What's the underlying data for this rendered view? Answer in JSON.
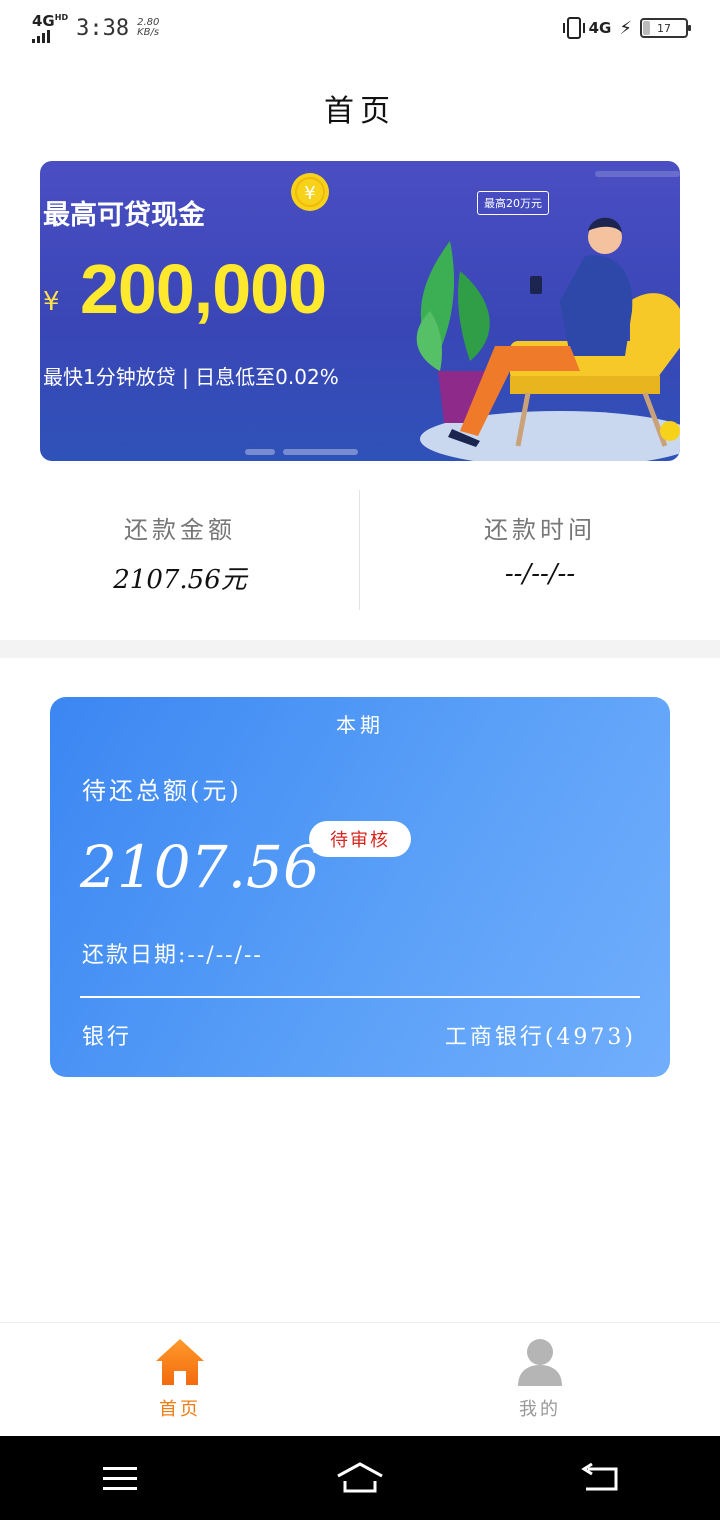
{
  "status_bar": {
    "network_left": "4G",
    "network_left_sup": "HD",
    "time": "3:38",
    "speed_value": "2.80",
    "speed_unit": "KB/s",
    "network_right": "4G",
    "battery_text": "17",
    "battery_level": 0.17
  },
  "header": {
    "title": "首页"
  },
  "banner": {
    "headline": "最高可贷现金",
    "currency": "¥",
    "amount": "200,000",
    "tagline": "最快1分钟放贷 | 日息低至0.02%",
    "bubble": "最高20万元",
    "coin_symbol": "¥"
  },
  "summary": {
    "amount_label": "还款金额",
    "amount_value": "2107.56元",
    "time_label": "还款时间",
    "time_value": "--/--/--"
  },
  "period_card": {
    "title": "本期",
    "pending_label": "待还总额(元)",
    "pending_amount": "2107.56",
    "status_badge": "待审核",
    "repay_date": "还款日期:--/--/--",
    "bank_label": "银行",
    "bank_value": "工商银行(4973)"
  },
  "tab_bar": {
    "home_label": "首页",
    "mine_label": "我的",
    "active_color": "#f07c14",
    "inactive_color": "#999999"
  },
  "icons": {
    "home": "home-icon",
    "profile": "profile-icon",
    "menu": "menu-icon",
    "nav_home": "nav-home-icon",
    "back": "back-icon"
  }
}
